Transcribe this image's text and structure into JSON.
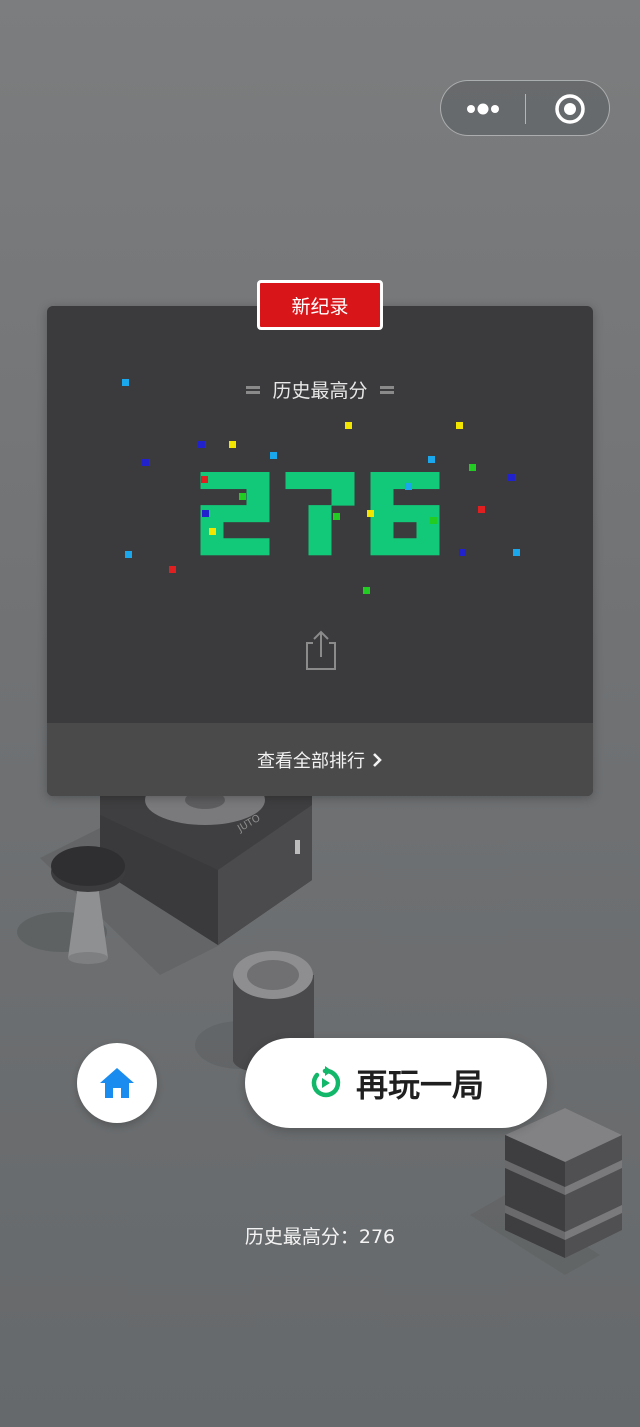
{
  "capsule": {
    "more_icon": "more-dots-icon",
    "close_icon": "target-circle-icon"
  },
  "card": {
    "badge": "新纪录",
    "title": "历史最高分",
    "score": "276",
    "share_icon": "share-icon",
    "rank_link": "查看全部排行",
    "rank_chevron": "›"
  },
  "buttons": {
    "home_icon": "home-icon",
    "replay_icon": "replay-icon",
    "replay_label": "再玩一局"
  },
  "footer": {
    "best_label": "历史最高分：",
    "best_value": "276"
  },
  "colors": {
    "score_green": "#12c97a",
    "badge_red": "#d8161a",
    "home_blue": "#1a8cf0",
    "replay_green": "#12b76a",
    "card_bg": "#3b3a3c"
  }
}
